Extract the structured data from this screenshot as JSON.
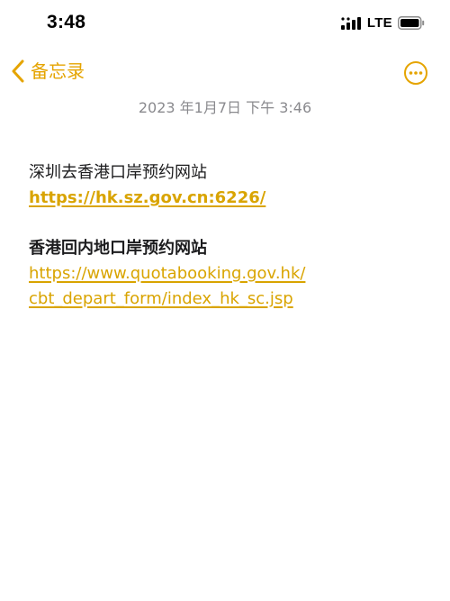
{
  "status_bar": {
    "time": "3:48",
    "network": "LTE",
    "icons": [
      "signal-icon",
      "battery-icon"
    ]
  },
  "nav": {
    "back_label": "备忘录",
    "back_icon": "chevron-left-icon",
    "more_icon": "ellipsis-circle-icon"
  },
  "note": {
    "date": "2023 年1月7日  下午 3:46",
    "sections": [
      {
        "heading": "深圳去香港口岸预约网站",
        "link": "https://hk.sz.gov.cn:6226/"
      },
      {
        "heading": "香港回内地口岸预约网站",
        "link_lines": [
          "https://www.quotabooking.gov.hk/",
          "cbt_depart_form/index_hk_sc.jsp"
        ]
      }
    ]
  },
  "colors": {
    "accent": "#e5a400",
    "link": "#d9a400",
    "date_gray": "#8a8a8e",
    "text": "#1c1c1e"
  }
}
